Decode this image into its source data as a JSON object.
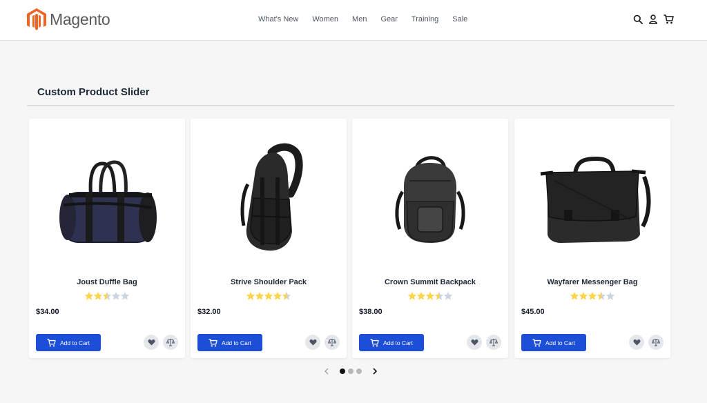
{
  "brand": {
    "name": "Magento",
    "accent": "#f26322"
  },
  "nav": {
    "items": [
      "What's New",
      "Women",
      "Men",
      "Gear",
      "Training",
      "Sale"
    ]
  },
  "header_icons": [
    "search-icon",
    "account-icon",
    "cart-icon"
  ],
  "section": {
    "title": "Custom Product Slider"
  },
  "products": [
    {
      "name": "Joust Duffle Bag",
      "price": "$34.00",
      "rating": 2.5,
      "image": "duffle-bag"
    },
    {
      "name": "Strive Shoulder Pack",
      "price": "$32.00",
      "rating": 4.5,
      "image": "shoulder-pack"
    },
    {
      "name": "Crown Summit Backpack",
      "price": "$38.00",
      "rating": 3.5,
      "image": "backpack"
    },
    {
      "name": "Wayfarer Messenger Bag",
      "price": "$45.00",
      "rating": 3.5,
      "image": "messenger-bag"
    }
  ],
  "card_actions": {
    "add_to_cart": "Add to Cart",
    "wishlist_icon": "heart-icon",
    "compare_icon": "scale-icon"
  },
  "slider": {
    "pages": 3,
    "active_page": 1
  },
  "colors": {
    "primary_button": "#1d4ed8",
    "star_filled": "#fcd34d",
    "star_empty": "#cbd5e1"
  }
}
